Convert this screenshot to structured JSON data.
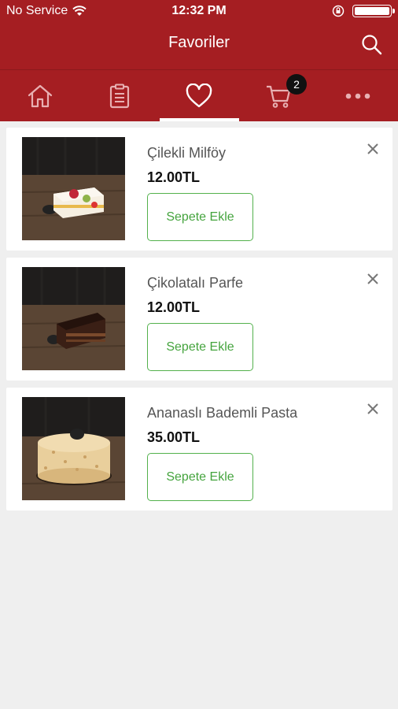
{
  "status_bar": {
    "carrier": "No Service",
    "time": "12:32 PM"
  },
  "header": {
    "title": "Favoriler",
    "search_icon": "search-icon"
  },
  "tabs": [
    {
      "icon": "home-icon",
      "active": false
    },
    {
      "icon": "clipboard-icon",
      "active": false
    },
    {
      "icon": "heart-icon",
      "active": true
    },
    {
      "icon": "cart-icon",
      "active": false,
      "badge": "2"
    },
    {
      "icon": "more-icon",
      "active": false
    }
  ],
  "favorites": [
    {
      "name": "Çilekli Milföy",
      "price": "12.00TL",
      "button": "Sepete Ekle",
      "image": "strawberry-pastry"
    },
    {
      "name": "Çikolatalı Parfe",
      "price": "12.00TL",
      "button": "Sepete Ekle",
      "image": "chocolate-parfait"
    },
    {
      "name": "Ananaslı Bademli Pasta",
      "price": "35.00TL",
      "button": "Sepete Ekle",
      "image": "pineapple-almond-cake"
    }
  ],
  "colors": {
    "brand": "#a51e22",
    "accent_green": "#45a43e",
    "background": "#efefef"
  }
}
